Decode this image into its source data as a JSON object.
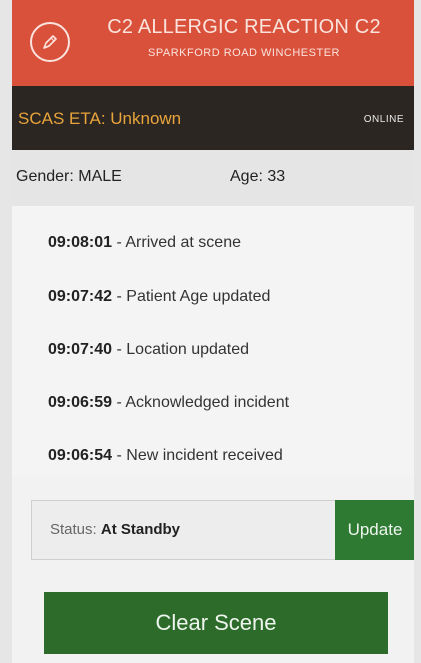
{
  "header": {
    "title": "C2 ALLERGIC REACTION C2",
    "subtitle": "SPARKFORD ROAD WINCHESTER",
    "icon": "pen-in-circle-icon",
    "color": "#d9513b"
  },
  "eta_bar": {
    "eta_label": "SCAS ETA: Unknown",
    "connection_status": "ONLINE"
  },
  "patient": {
    "gender": "Gender: MALE",
    "age": "Age: 33"
  },
  "log": [
    {
      "time": "09:08:01",
      "text": " - Arrived at scene"
    },
    {
      "time": "09:07:42",
      "text": " - Patient Age updated"
    },
    {
      "time": "09:07:40",
      "text": " - Location updated"
    },
    {
      "time": "09:06:59",
      "text": " - Acknowledged incident"
    },
    {
      "time": "09:06:54",
      "text": " - New incident received"
    }
  ],
  "status": {
    "label": "Status: ",
    "value": "At Standby",
    "update_label": "Update"
  },
  "actions": {
    "clear_scene_label": "Clear Scene"
  }
}
